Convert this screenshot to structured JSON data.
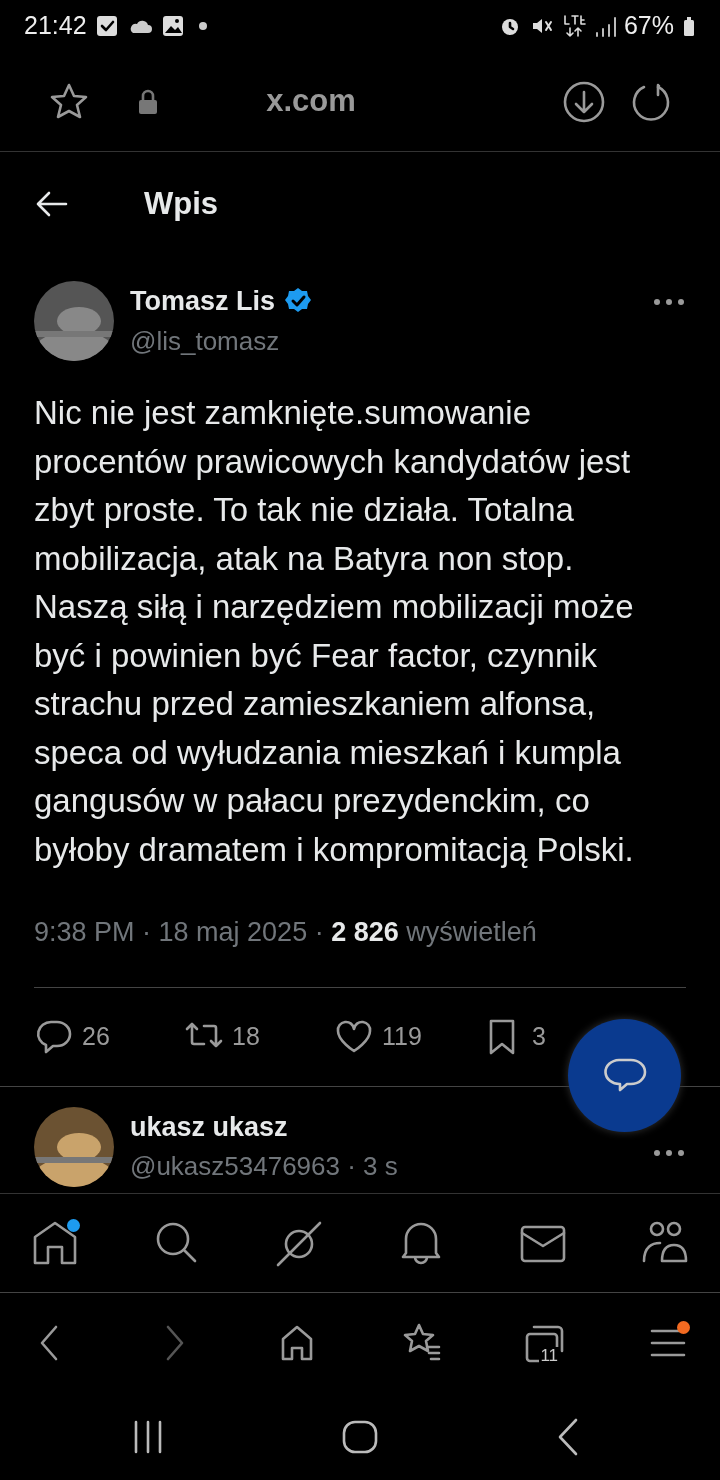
{
  "status_bar": {
    "time": "21:42",
    "battery": "67%"
  },
  "browser_bar": {
    "url": "x.com"
  },
  "header": {
    "title": "Wpis"
  },
  "tweet": {
    "name": "Tomasz Lis",
    "verified": true,
    "handle": "@lis_tomasz",
    "text": "Nic nie jest zamknięte.sumowanie procentów prawicowych kandydatów jest zbyt proste. To tak nie działa. Totalna mobilizacja, atak na Batyra non stop. Naszą siłą i narzędziem mobilizacji może być i powinien być Fear factor, czynnik strachu przed zamieszkaniem alfonsa, speca od wyłudzania mieszkań i kumpla gangusów w pałacu prezydenckim, co byłoby dramatem i kompromitacją Polski.",
    "meta": "9:38 PM · 18 maj 2025 · **2 826** wyświetleń",
    "actions": [
      {
        "count": "26"
      },
      {
        "count": "18"
      },
      {
        "count": "119"
      },
      {
        "count": "3"
      }
    ]
  },
  "reply": {
    "name": "ukasz ukasz",
    "handle": "@ukasz53476963 · 3 s"
  },
  "tab_bar": [
    {
      "badge": true
    },
    {
      "badge": false
    },
    {
      "badge": false
    },
    {
      "badge": false
    },
    {
      "badge": false
    },
    {
      "badge": false
    }
  ],
  "browser_nav": [
    {
      "disabled": false,
      "badge": false
    },
    {
      "disabled": true,
      "badge": false
    },
    {
      "disabled": false,
      "badge": false
    },
    {
      "disabled": false,
      "badge": false
    },
    {
      "disabled": false,
      "badge": false,
      "tab_count": "11"
    },
    {
      "disabled": false,
      "badge": true
    }
  ]
}
